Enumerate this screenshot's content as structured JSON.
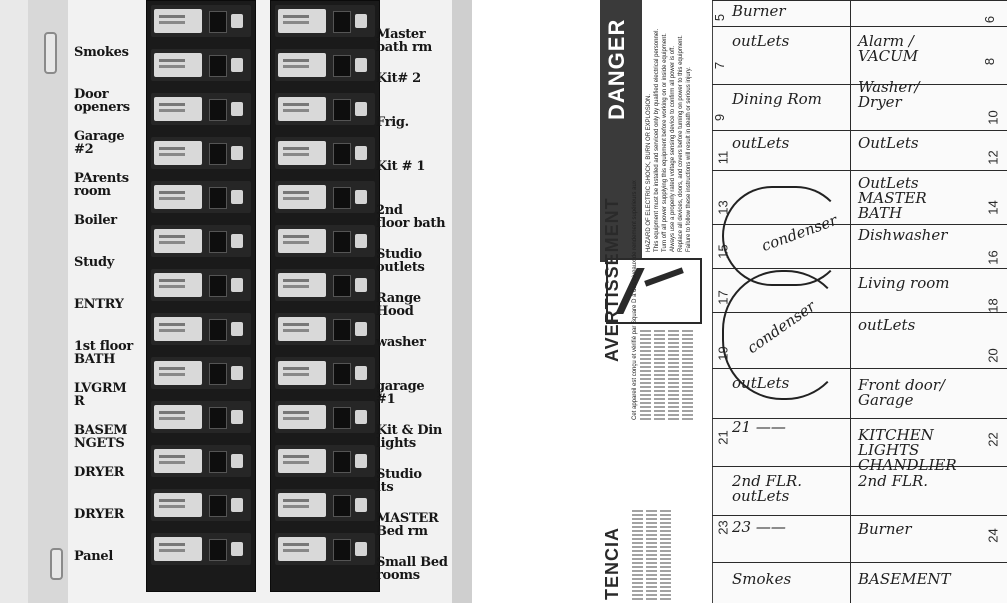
{
  "left_panel": {
    "left_labels": [
      "Smokes",
      "Door\nopeners",
      "Garage\n#2",
      "PArents\nroom",
      "Boiler",
      "Study",
      "ENTRY",
      "1st floor\nBATH",
      "LVGRM\nR",
      "BASEM\nNGETS",
      "DRYER",
      "DRYER",
      "Panel"
    ],
    "right_labels": [
      "Master\nbath rm",
      "Kit# 2",
      "Frig.",
      "Kit # 1",
      "2nd\nfloor bath",
      "Studio\noutlets",
      "Range Hood",
      "washer",
      "garage\n#1",
      "Kit & Din\nlights",
      "Studio\nlts",
      "MASTER\nBed rm",
      "Small Bed\nrooms"
    ]
  },
  "right_panel": {
    "danger_title": "DANGER",
    "danger_text": "HAZARD OF ELECTRIC SHOCK, BURN OR EXPLOSION.",
    "danger_line2": "This equipment must be installed and serviced only by qualified electrical personnel.",
    "danger_line3": "Turn off all power supplying this equipment before working on or inside equipment.",
    "danger_line4": "Always use a properly rated voltage sensing device to confirm all power is off.",
    "danger_line5": "Replace all devices, doors, and covers before turning on power to this equipment.",
    "danger_line6": "Failure to follow these instructions will result in death or serious injury.",
    "avert_title": "AVERTISSEMENT",
    "avert_text": "Cet appareil est conçu et vérifié par Square D à des niveaux de rendement supérieurs aux",
    "tencia_title": "TENCIA",
    "circuits_left": [
      "Burner",
      "outLets",
      "Dining Rom",
      "outLets",
      "",
      "",
      "",
      "",
      "outLets",
      "21 ——",
      "2nd FLR.\noutLets",
      "23 ——",
      "Smokes"
    ],
    "circuits_right": [
      "",
      "Alarm /\nVACUM",
      "Washer/\nDryer",
      "OutLets",
      "OutLets\nMASTER\nBATH",
      "Dishwasher",
      "Living room",
      "outLets",
      "Front door/\nGarage",
      "KITCHEN\nLIGHTS\nCHANDLIER",
      "2nd FLR.",
      "Burner",
      "BASEMENT"
    ],
    "condenser_1": "condenser",
    "condenser_2": "condenser",
    "numbers_left": [
      "5",
      "7",
      "9",
      "11",
      "13",
      "15",
      "17",
      "19",
      "21",
      "23"
    ],
    "numbers_right": [
      "6",
      "8",
      "10",
      "12",
      "14",
      "16",
      "18",
      "20",
      "22",
      "24"
    ]
  }
}
